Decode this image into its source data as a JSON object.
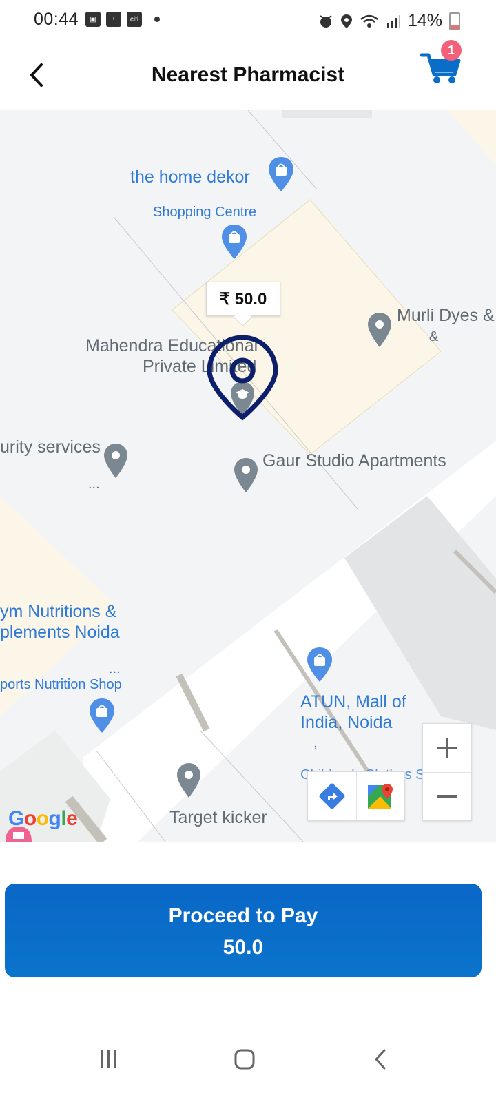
{
  "status": {
    "time": "00:44",
    "carrier_icon_text": "citi",
    "battery": "14%"
  },
  "header": {
    "title": "Nearest Pharmacist",
    "cart_count": "1",
    "accent": "#0a6ec8",
    "badge_color": "#f2607a"
  },
  "map": {
    "price_tag": "₹ 50.0",
    "places": {
      "home_dekor": "the home dekor",
      "shopping_centre": "Shopping Centre",
      "murli_line1": "Murli Dyes &",
      "murli_line2": "&",
      "mahendra_line1": "Mahendra Educational",
      "mahendra_line2": "Private Limited",
      "security_services": "urity services",
      "security_more": "...",
      "gaur_studio": "Gaur Studio Apartments",
      "gym_line1": "ym Nutritions &",
      "gym_line2": "plements Noida",
      "gym_more": "...",
      "sports_nutrition": "ports Nutrition Shop",
      "atun_line1": "ATUN, Mall of",
      "atun_line2": "India, Noida",
      "atun_extra": ",",
      "childrens_clothes": "Children's Clothes Shop",
      "target_kicker": "Target kicker"
    },
    "attribution": "Google",
    "zoom_in_icon": "plus-icon",
    "zoom_out_icon": "minus-icon",
    "directions_icon": "directions-icon",
    "maps_icon": "google-maps-icon"
  },
  "payment": {
    "button_label": "Proceed to Pay",
    "amount": "50.0"
  }
}
